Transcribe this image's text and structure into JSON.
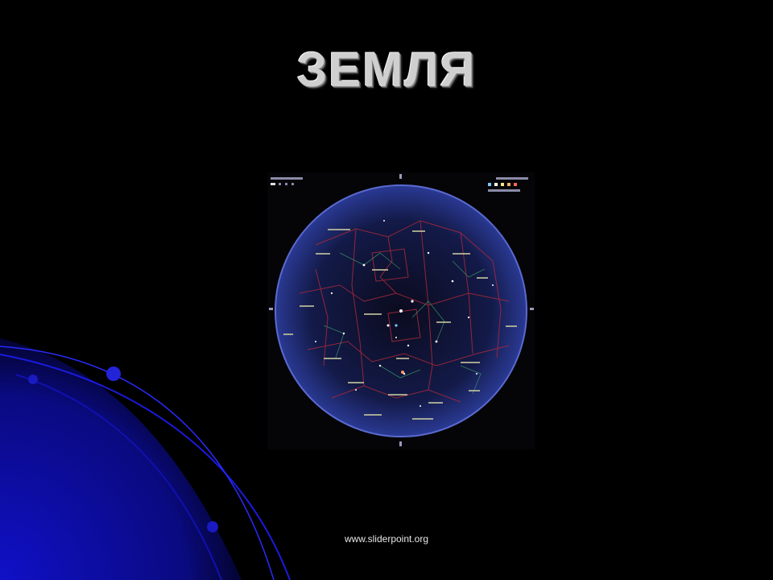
{
  "slide": {
    "title": "ЗЕМЛЯ",
    "footer_link": "www.sliderpoint.org"
  },
  "colors": {
    "background": "#000000",
    "accent_blue": "#1a1aff",
    "title_text": "#cfcfcf",
    "map_disc": "#1c2a6e",
    "constellation_lines": "#b02a3a"
  },
  "image": {
    "name": "sky-star-map"
  }
}
